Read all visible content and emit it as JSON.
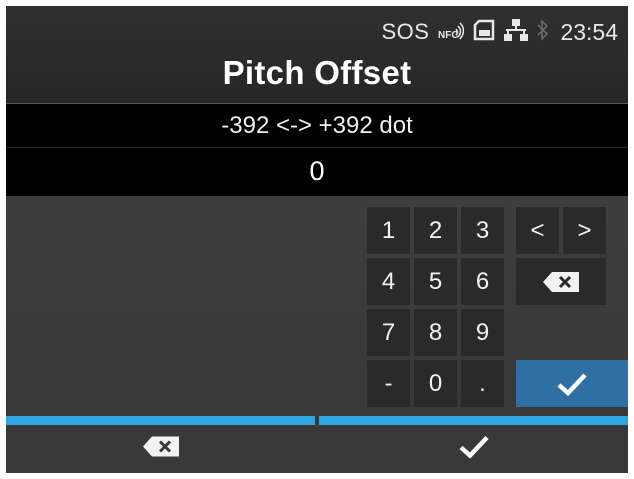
{
  "status_bar": {
    "sos": "SOS",
    "time": "23:54",
    "icons": [
      "nfc-icon",
      "sd-card-icon",
      "lan-icon",
      "bluetooth-icon"
    ]
  },
  "title": "Pitch Offset",
  "range": "-392 <-> +392 dot",
  "value": "0",
  "keypad": {
    "row1": [
      "1",
      "2",
      "3"
    ],
    "row2": [
      "4",
      "5",
      "6"
    ],
    "row3": [
      "7",
      "8",
      "9"
    ],
    "row4": [
      "-",
      "0",
      "."
    ],
    "left_arrow": "<",
    "right_arrow": ">"
  },
  "colors": {
    "accent_blue": "#2ea7e0",
    "enter_key": "#2f6fa3",
    "key_bg": "#2a2a2a"
  }
}
